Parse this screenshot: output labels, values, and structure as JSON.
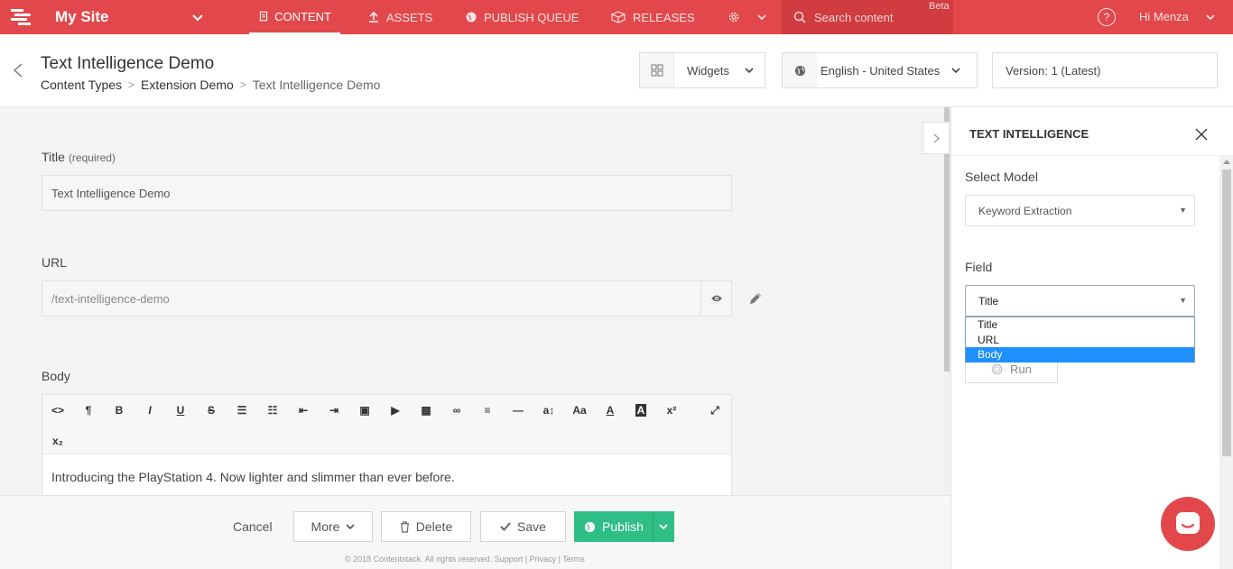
{
  "nav": {
    "site_name": "My Site",
    "items": [
      {
        "label": "CONTENT",
        "icon": "document-icon",
        "active": true
      },
      {
        "label": "ASSETS",
        "icon": "upload-icon"
      },
      {
        "label": "PUBLISH QUEUE",
        "icon": "globe-icon"
      },
      {
        "label": "RELEASES",
        "icon": "box-icon"
      }
    ],
    "search_placeholder": "Search content",
    "beta": "Beta",
    "help": "?",
    "user": "Hi  Menza"
  },
  "header": {
    "title": "Text Intelligence Demo",
    "breadcrumb": [
      "Content Types",
      "Extension Demo",
      "Text Intelligence Demo"
    ],
    "widgets_label": "Widgets",
    "locale_label": "English - United States",
    "version_label": "Version: 1 (Latest)"
  },
  "form": {
    "title_label": "Title",
    "title_required": "(required)",
    "title_value": "Text Intelligence Demo",
    "url_label": "URL",
    "url_value": "/text-intelligence-demo",
    "body_label": "Body",
    "body_text": "Introducing the PlayStation 4. Now lighter and slimmer than ever before."
  },
  "footer": {
    "cancel": "Cancel",
    "more": "More",
    "delete": "Delete",
    "save": "Save",
    "publish": "Publish",
    "copyright": "© 2018 Contentstack. All rights reserved. Support | Privacy | Terms"
  },
  "panel": {
    "title": "TEXT INTELLIGENCE",
    "model_label": "Select Model",
    "model_value": "Keyword Extraction",
    "field_label": "Field",
    "field_value": "Title",
    "field_options": [
      "Title",
      "URL",
      "Body"
    ],
    "highlighted_option": "Body",
    "run": "Run"
  },
  "colors": {
    "brand": "#e2484b",
    "publish": "#2fbe85",
    "highlight": "#1e90ff"
  }
}
